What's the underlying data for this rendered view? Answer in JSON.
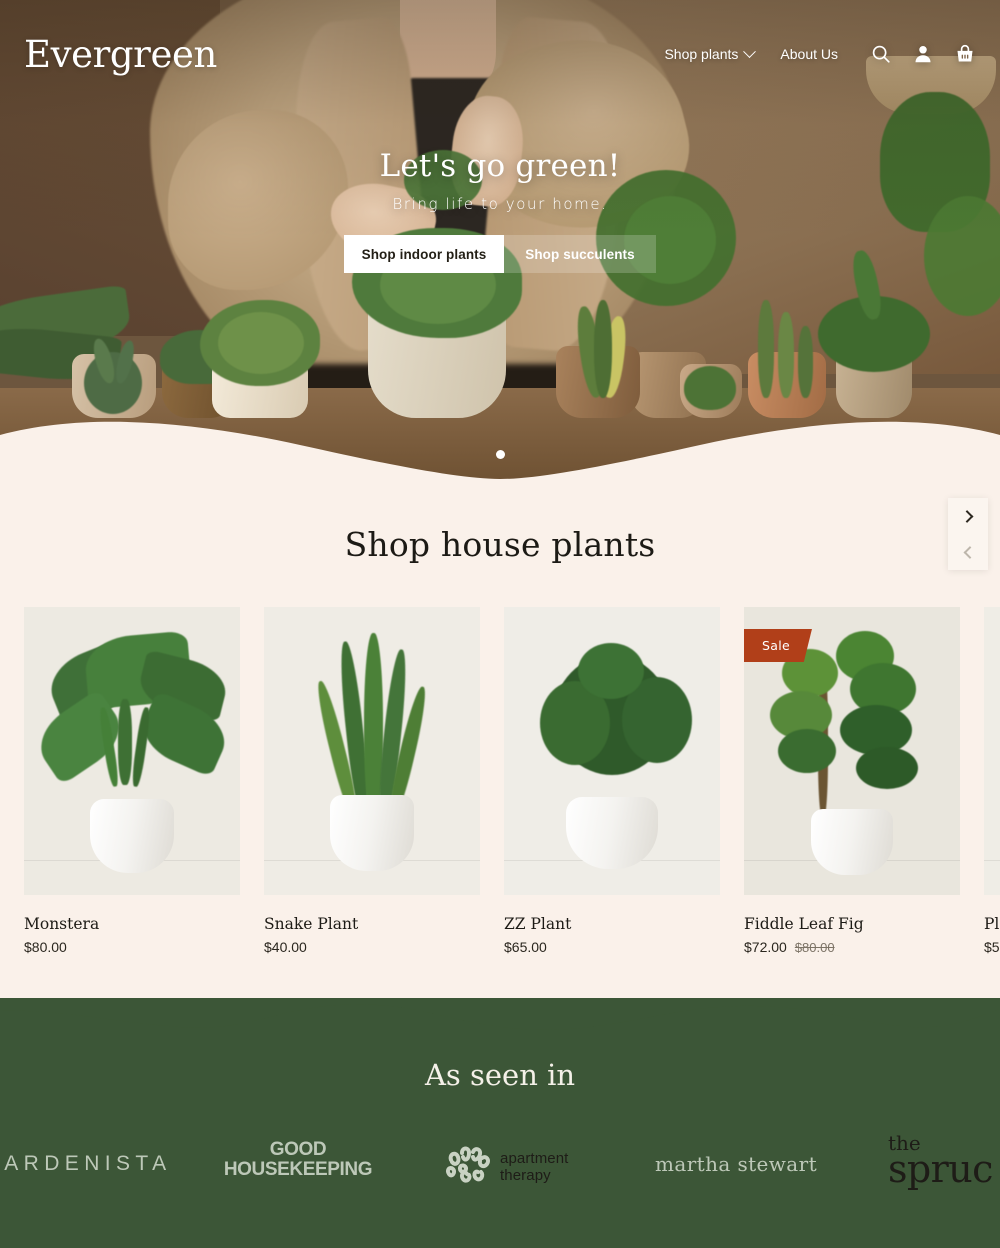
{
  "brand": {
    "name": "Evergreen"
  },
  "header": {
    "nav": [
      {
        "label": "Shop plants",
        "icon": "chevron-down-icon",
        "has_dropdown": true
      },
      {
        "label": "About Us",
        "has_dropdown": false
      }
    ],
    "icons": [
      {
        "name": "search-icon",
        "label": "Search"
      },
      {
        "name": "account-icon",
        "label": "Account"
      },
      {
        "name": "cart-icon",
        "label": "Cart"
      }
    ]
  },
  "hero": {
    "title": "Let's go green!",
    "subtitle": "Bring life to your home.",
    "primary_button": "Shop indoor plants",
    "secondary_button": "Shop succulents",
    "carousel_dots": 1,
    "active_dot": 0
  },
  "shop": {
    "title": "Shop house plants",
    "sale_badge_label": "Sale",
    "next_label": "Next",
    "prev_label": "Previous",
    "products": [
      {
        "name": "Monstera",
        "price": "$80.00",
        "compare_at": "",
        "on_sale": false
      },
      {
        "name": "Snake Plant",
        "price": "$40.00",
        "compare_at": "",
        "on_sale": false
      },
      {
        "name": "ZZ Plant",
        "price": "$65.00",
        "compare_at": "",
        "on_sale": false
      },
      {
        "name": "Fiddle Leaf Fig",
        "price": "$72.00",
        "compare_at": "$80.00",
        "on_sale": true
      },
      {
        "name": "Pl",
        "price": "$5",
        "compare_at": "",
        "on_sale": false
      }
    ]
  },
  "press": {
    "title": "As seen in",
    "logos": [
      {
        "name": "GARDENISTA"
      },
      {
        "name": "GOOD",
        "name2": "HOUSEKEEPING"
      },
      {
        "name": "apartment",
        "name2": "therapy"
      },
      {
        "name": "martha stewart"
      },
      {
        "name": "the",
        "name2": "spruc"
      }
    ]
  },
  "colors": {
    "cream": "#FAF1EA",
    "green": "#3C5637",
    "sale": "#B13F19",
    "text": "#1C1A15"
  }
}
